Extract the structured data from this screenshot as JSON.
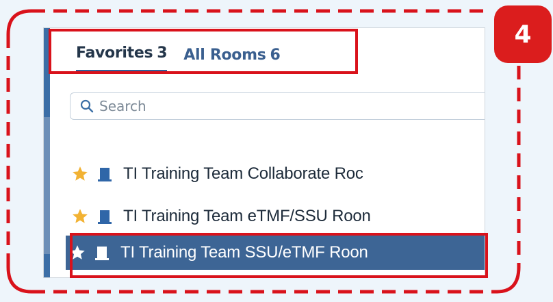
{
  "tabs": [
    {
      "label": "Favorites",
      "count": "3",
      "active": true
    },
    {
      "label": "All Rooms",
      "count": "6",
      "active": false
    }
  ],
  "search": {
    "placeholder": "Search",
    "value": ""
  },
  "rooms": [
    {
      "name": "TI Training Team Collaborate Roc",
      "favorite": true,
      "selected": false
    },
    {
      "name": "TI Training Team eTMF/SSU Roon",
      "favorite": true,
      "selected": false
    },
    {
      "name": "TI Training Team SSU/eTMF Roon",
      "favorite": true,
      "selected": true
    }
  ],
  "annotation": {
    "step_number": "4"
  },
  "colors": {
    "highlight_red": "#d9121b",
    "star_gold": "#f2b233",
    "door_blue": "#2f66a8",
    "selected_row": "#3d6595",
    "tab_underline": "#2f5f9a"
  }
}
